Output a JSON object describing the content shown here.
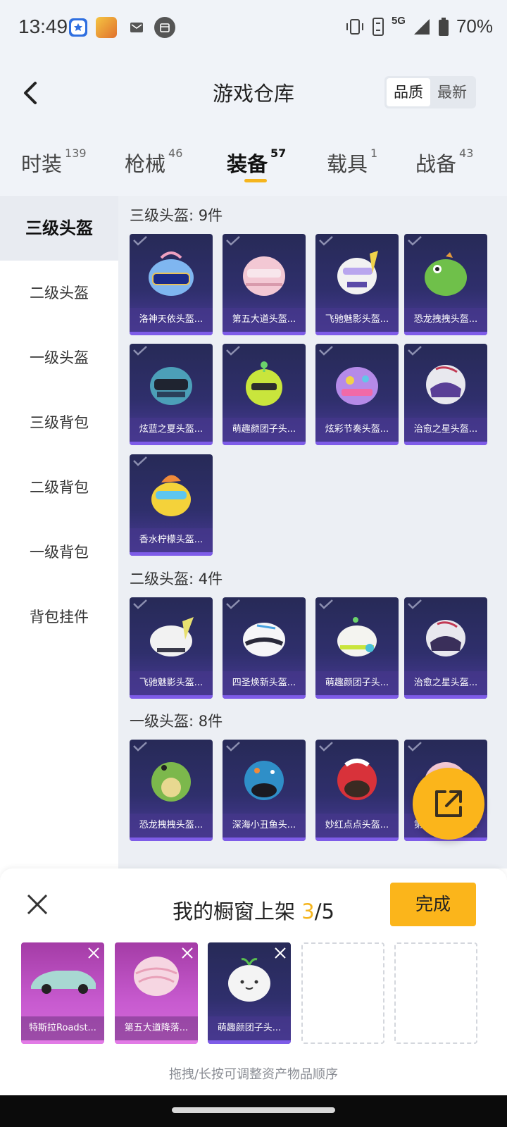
{
  "status_bar": {
    "time": "13:49",
    "network": "5G",
    "battery": "70%"
  },
  "header": {
    "title": "游戏仓库",
    "sort_options": [
      "品质",
      "最新"
    ],
    "active_sort": "品质"
  },
  "tabs": [
    {
      "label": "时装",
      "count": "139"
    },
    {
      "label": "枪械",
      "count": "46"
    },
    {
      "label": "装备",
      "count": "57",
      "active": true
    },
    {
      "label": "载具",
      "count": "1"
    },
    {
      "label": "战备",
      "count": "43"
    }
  ],
  "sidebar": [
    "三级头盔",
    "二级头盔",
    "一级头盔",
    "三级背包",
    "二级背包",
    "一级背包",
    "背包挂件"
  ],
  "sections": [
    {
      "title": "三级头盔: 9件",
      "items": [
        "洛神天依头盔...",
        "第五大道头盔...",
        "飞驰魅影头盔...",
        "恐龙拽拽头盔...",
        "炫蓝之夏头盔...",
        "萌趣颜团子头...",
        "炫彩节奏头盔...",
        "治愈之星头盔...",
        "香水柠檬头盔..."
      ]
    },
    {
      "title": "二级头盔: 4件",
      "items": [
        "飞驰魅影头盔...",
        "四圣焕新头盔...",
        "萌趣颜团子头...",
        "治愈之星头盔..."
      ]
    },
    {
      "title": "一级头盔: 8件",
      "items": [
        "恐龙拽拽头盔...",
        "深海小丑鱼头...",
        "妙红点点头盔...",
        "第五大道头盔..."
      ]
    }
  ],
  "panel": {
    "title_prefix": "我的橱窗上架 ",
    "selected": "3",
    "title_suffix": "/5",
    "done_label": "完成",
    "shelf": [
      "特斯拉Roadst...",
      "第五大道降落...",
      "萌趣颜团子头..."
    ],
    "hint": "拖拽/长按可调整资产物品顺序"
  }
}
